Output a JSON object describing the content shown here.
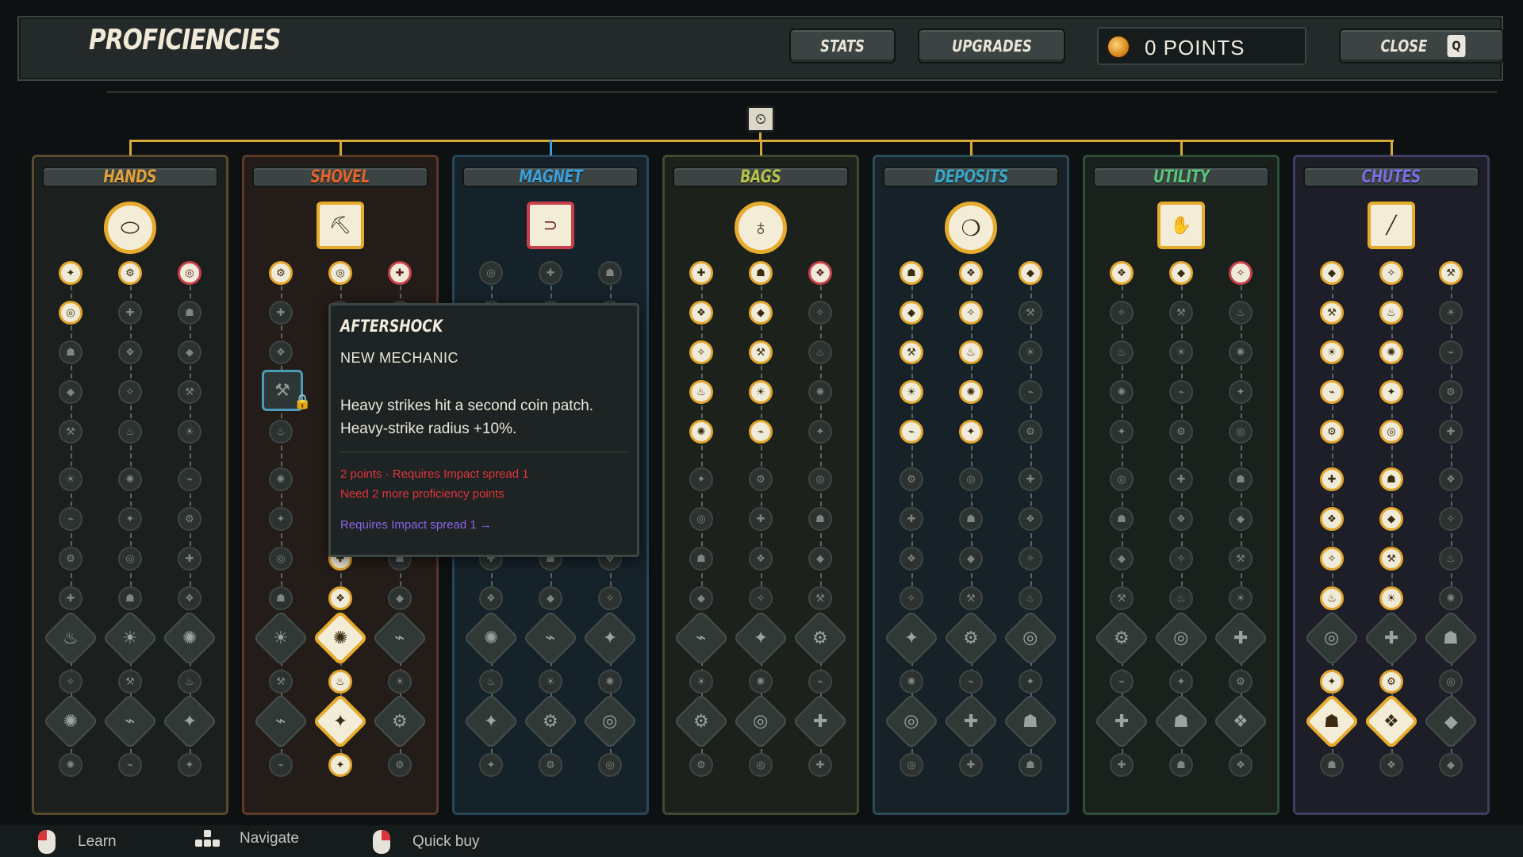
{
  "header": {
    "title": "PROFICIENCIES",
    "stats": "STATS",
    "upgrades": "UPGRADES",
    "points": "0 POINTS",
    "close": "CLOSE",
    "close_key": "Q"
  },
  "colors": {
    "accent": "#e6ab2c",
    "locked": "#c8404a",
    "mechanic": "#8e63e6"
  },
  "columns": [
    {
      "label": "HANDS",
      "color": "#e3a13a"
    },
    {
      "label": "SHOVEL",
      "color": "#e0642e"
    },
    {
      "label": "MAGNET",
      "color": "#3b9fdc"
    },
    {
      "label": "BAGS",
      "color": "#b7c24a"
    },
    {
      "label": "DEPOSITS",
      "color": "#3aa6c8"
    },
    {
      "label": "UTILITY",
      "color": "#59c67a"
    },
    {
      "label": "CHUTES",
      "color": "#7d6ee2"
    }
  ],
  "tooltip": {
    "title": "AFTERSHOCK",
    "subtitle": "NEW MECHANIC",
    "desc1": "Heavy strikes hit a second coin patch.",
    "desc2": "Heavy-strike radius +10%.",
    "req1": "2 points · Requires Impact spread 1",
    "req2": "Need 2 more proficiency points",
    "link": "Requires Impact spread 1 →"
  },
  "hints": {
    "learn": "Learn",
    "navigate": "Navigate",
    "quick_buy": "Quick buy"
  }
}
